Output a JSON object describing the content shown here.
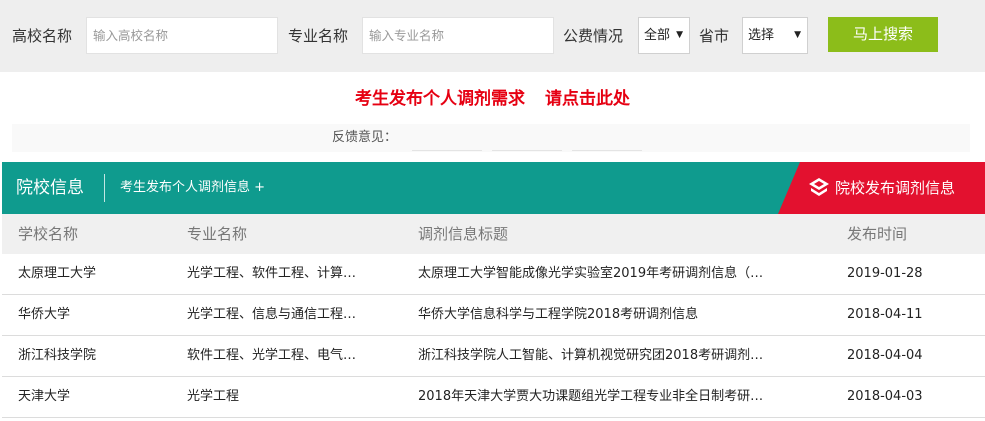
{
  "search": {
    "school_label": "高校名称",
    "school_placeholder": "输入高校名称",
    "major_label": "专业名称",
    "major_placeholder": "输入专业名称",
    "fee_label": "公费情况",
    "fee_value": "全部",
    "province_label": "省市",
    "province_value": "选择",
    "button_label": "马上搜索"
  },
  "promo": {
    "part1": "考生发布个人调剂需求",
    "part2": "请点击此处"
  },
  "feedback": {
    "label": "反馈意见："
  },
  "tabs": {
    "title": "院校信息",
    "link": "考生发布个人调剂信息 +",
    "red_button": "院校发布调剂信息"
  },
  "table": {
    "headers": [
      "学校名称",
      "专业名称",
      "调剂信息标题",
      "发布时间"
    ],
    "rows": [
      {
        "school": "太原理工大学",
        "major": "光学工程、软件工程、计算…",
        "title": "太原理工大学智能成像光学实验室2019年考研调剂信息（…",
        "date": "2019-01-28"
      },
      {
        "school": "华侨大学",
        "major": "光学工程、信息与通信工程…",
        "title": "华侨大学信息科学与工程学院2018考研调剂信息",
        "date": "2018-04-11"
      },
      {
        "school": "浙江科技学院",
        "major": "软件工程、光学工程、电气…",
        "title": "浙江科技学院人工智能、计算机视觉研究团2018考研调剂…",
        "date": "2018-04-04"
      },
      {
        "school": "天津大学",
        "major": "光学工程",
        "title": "2018年天津大学贾大功课题组光学工程专业非全日制考研…",
        "date": "2018-04-03"
      }
    ]
  },
  "colors": {
    "teal": "#0f9b8e",
    "red": "#e3112f",
    "green_button": "#8cbd1a",
    "promo_red": "#e60012"
  }
}
